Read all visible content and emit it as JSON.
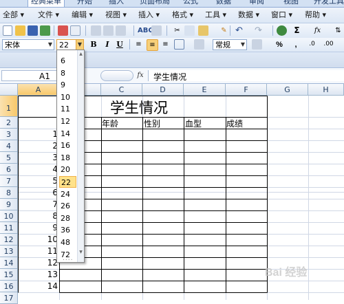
{
  "ribbon_tabs": [
    "经典菜单",
    "开始",
    "插入",
    "页面布局",
    "公式",
    "数据",
    "审阅",
    "视图",
    "开发工具"
  ],
  "menu_items": [
    "全部",
    "文件",
    "编辑",
    "视图",
    "插入",
    "格式",
    "工具",
    "数据",
    "窗口",
    "帮助"
  ],
  "font_name": "宋体",
  "font_size": "22",
  "style_name": "常规",
  "format_buttons": {
    "bold": "B",
    "italic": "I",
    "underline": "U",
    "percent": "%",
    "comma": ","
  },
  "formula_bar": {
    "name_box": "A1",
    "fx": "fx",
    "content": "学生情况"
  },
  "columns": [
    "A",
    "B",
    "C",
    "D",
    "E",
    "F",
    "G",
    "H"
  ],
  "rows": [
    "1",
    "2",
    "3",
    "4",
    "5",
    "6",
    "7",
    "8",
    "9",
    "10",
    "11",
    "12",
    "13",
    "14",
    "15",
    "16",
    "17"
  ],
  "sheet": {
    "title": "学生情况",
    "headers": [
      "年龄",
      "性别",
      "血型",
      "成绩"
    ],
    "col_a_numbers": [
      "1",
      "2",
      "3",
      "4",
      "5",
      "6",
      "7",
      "8",
      "9",
      "10",
      "11",
      "12",
      "13",
      "14"
    ]
  },
  "font_size_options": [
    "6",
    "8",
    "9",
    "10",
    "11",
    "12",
    "14",
    "16",
    "18",
    "20",
    "22",
    "24",
    "26",
    "28",
    "36",
    "48",
    "72"
  ],
  "dropdown_footer": "....",
  "watermark": "Bai 经验"
}
